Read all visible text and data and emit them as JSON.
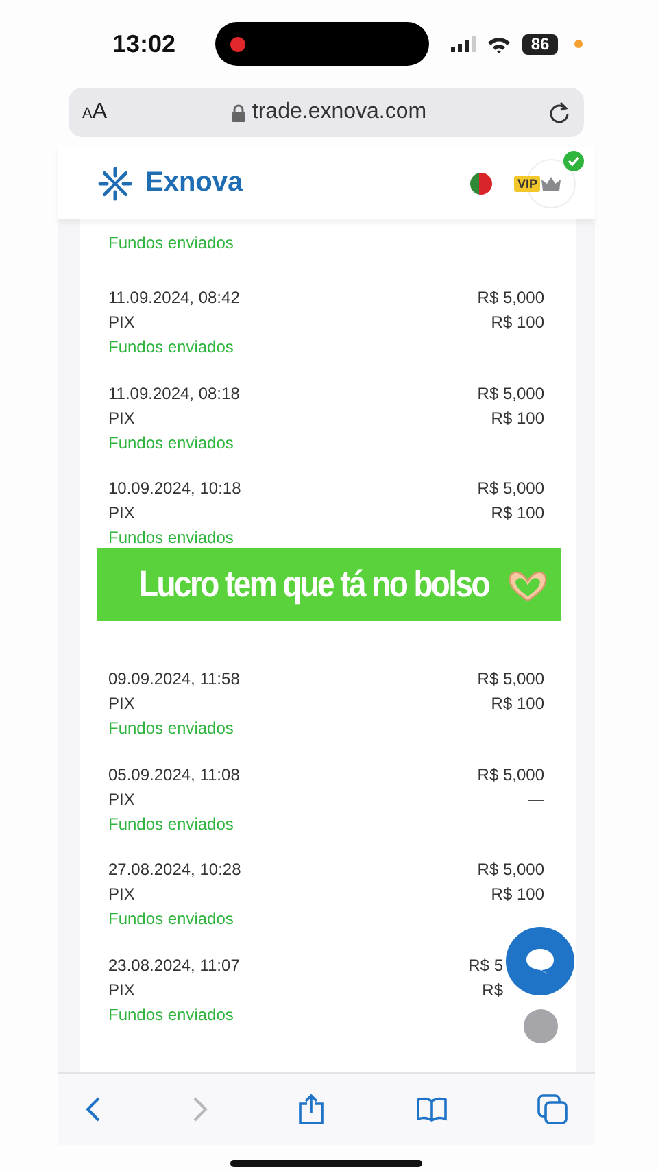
{
  "status_bar": {
    "time": "13:02",
    "battery": "86"
  },
  "address_bar": {
    "text_size": "AA",
    "url": "trade.exnova.com"
  },
  "header": {
    "brand": "Exnova",
    "vip_badge": "VIP"
  },
  "transactions": [
    {
      "kind": "cut_top",
      "status": "Fundos enviados"
    },
    {
      "date": "11.09.2024, 08:42",
      "method": "PIX",
      "amount": "R$ 5,000",
      "fee": "R$ 100",
      "status": "Fundos enviados"
    },
    {
      "date": "11.09.2024, 08:18",
      "method": "PIX",
      "amount": "R$ 5,000",
      "fee": "R$ 100",
      "status": "Fundos enviados"
    },
    {
      "date": "10.09.2024, 10:18",
      "method": "PIX",
      "amount": "R$ 5,000",
      "fee": "R$ 100",
      "status": "Fundos enviados"
    },
    {
      "kind": "covered"
    },
    {
      "date": "09.09.2024, 11:58",
      "method": "PIX",
      "amount": "R$ 5,000",
      "fee": "R$ 100",
      "status": "Fundos enviados"
    },
    {
      "date": "05.09.2024, 11:08",
      "method": "PIX",
      "amount": "R$ 5,000",
      "fee": "—",
      "status": "Fundos enviados"
    },
    {
      "date": "27.08.2024, 10:28",
      "method": "PIX",
      "amount": "R$ 5,000",
      "fee": "R$ 100",
      "status": "Fundos enviados"
    },
    {
      "kind": "beside_button",
      "date": "23.08.2024, 11:07",
      "method": "PIX",
      "amount": "R$ 5",
      "fee": "R$",
      "status": "Fundos enviados"
    }
  ],
  "banner": {
    "text": "Lucro tem que tá no bolso"
  },
  "toolbar": [
    {
      "kind": "back",
      "disabled": false
    },
    {
      "kind": "forward",
      "disabled": true
    },
    {
      "kind": "share",
      "disabled": false
    },
    {
      "kind": "bookmarks",
      "disabled": false
    },
    {
      "kind": "tabs",
      "disabled": false
    }
  ]
}
